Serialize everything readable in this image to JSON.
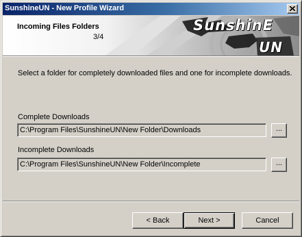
{
  "window": {
    "title": "SunshineUN - New Profile Wizard"
  },
  "header": {
    "title": "Incoming Files Folders",
    "step": "3/4",
    "logo_main": "SunshinE",
    "logo_sub": "UN"
  },
  "instruction": "Select a folder for completely downloaded files and one for incomplete downloads.",
  "complete": {
    "label": "Complete Downloads",
    "path": "C:\\Program Files\\SunshineUN\\New Folder\\Downloads",
    "browse_label": "..."
  },
  "incomplete": {
    "label": "Incomplete Downloads",
    "path": "C:\\Program Files\\SunshineUN\\New Folder\\Incomplete",
    "browse_label": "..."
  },
  "buttons": {
    "back": "< Back",
    "next": "Next >",
    "cancel": "Cancel"
  }
}
